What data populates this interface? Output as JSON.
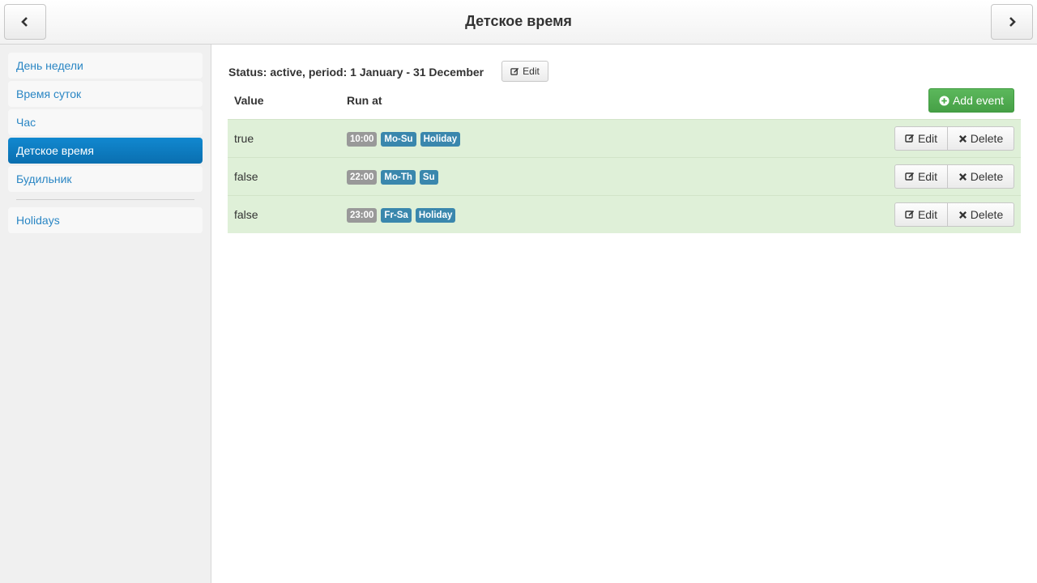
{
  "header": {
    "title": "Детское время",
    "prev_icon": "chevron-left-icon",
    "next_icon": "chevron-right-icon"
  },
  "sidebar": {
    "items": [
      {
        "label": "День недели",
        "active": false
      },
      {
        "label": "Время суток",
        "active": false
      },
      {
        "label": "Час",
        "active": false
      },
      {
        "label": "Детское время",
        "active": true
      },
      {
        "label": "Будильник",
        "active": false
      }
    ],
    "extra_items": [
      {
        "label": "Holidays"
      }
    ]
  },
  "main": {
    "status_text": "Status: active, period: 1 January - 31 December",
    "status_edit_label": "Edit",
    "columns": {
      "value": "Value",
      "run_at": "Run at"
    },
    "add_event_label": "Add event",
    "rows": [
      {
        "value": "true",
        "time": "10:00",
        "days": [
          "Mo-Su",
          "Holiday"
        ],
        "edit_label": "Edit",
        "delete_label": "Delete"
      },
      {
        "value": "false",
        "time": "22:00",
        "days": [
          "Mo-Th",
          "Su"
        ],
        "edit_label": "Edit",
        "delete_label": "Delete"
      },
      {
        "value": "false",
        "time": "23:00",
        "days": [
          "Fr-Sa",
          "Holiday"
        ],
        "edit_label": "Edit",
        "delete_label": "Delete"
      }
    ]
  },
  "colors": {
    "active_item": "#0a7cc0",
    "row_bg": "#dff0d8",
    "success": "#5cb85c",
    "label_day": "#3a87ad",
    "label_time": "#999999",
    "link": "#2a86c4"
  }
}
